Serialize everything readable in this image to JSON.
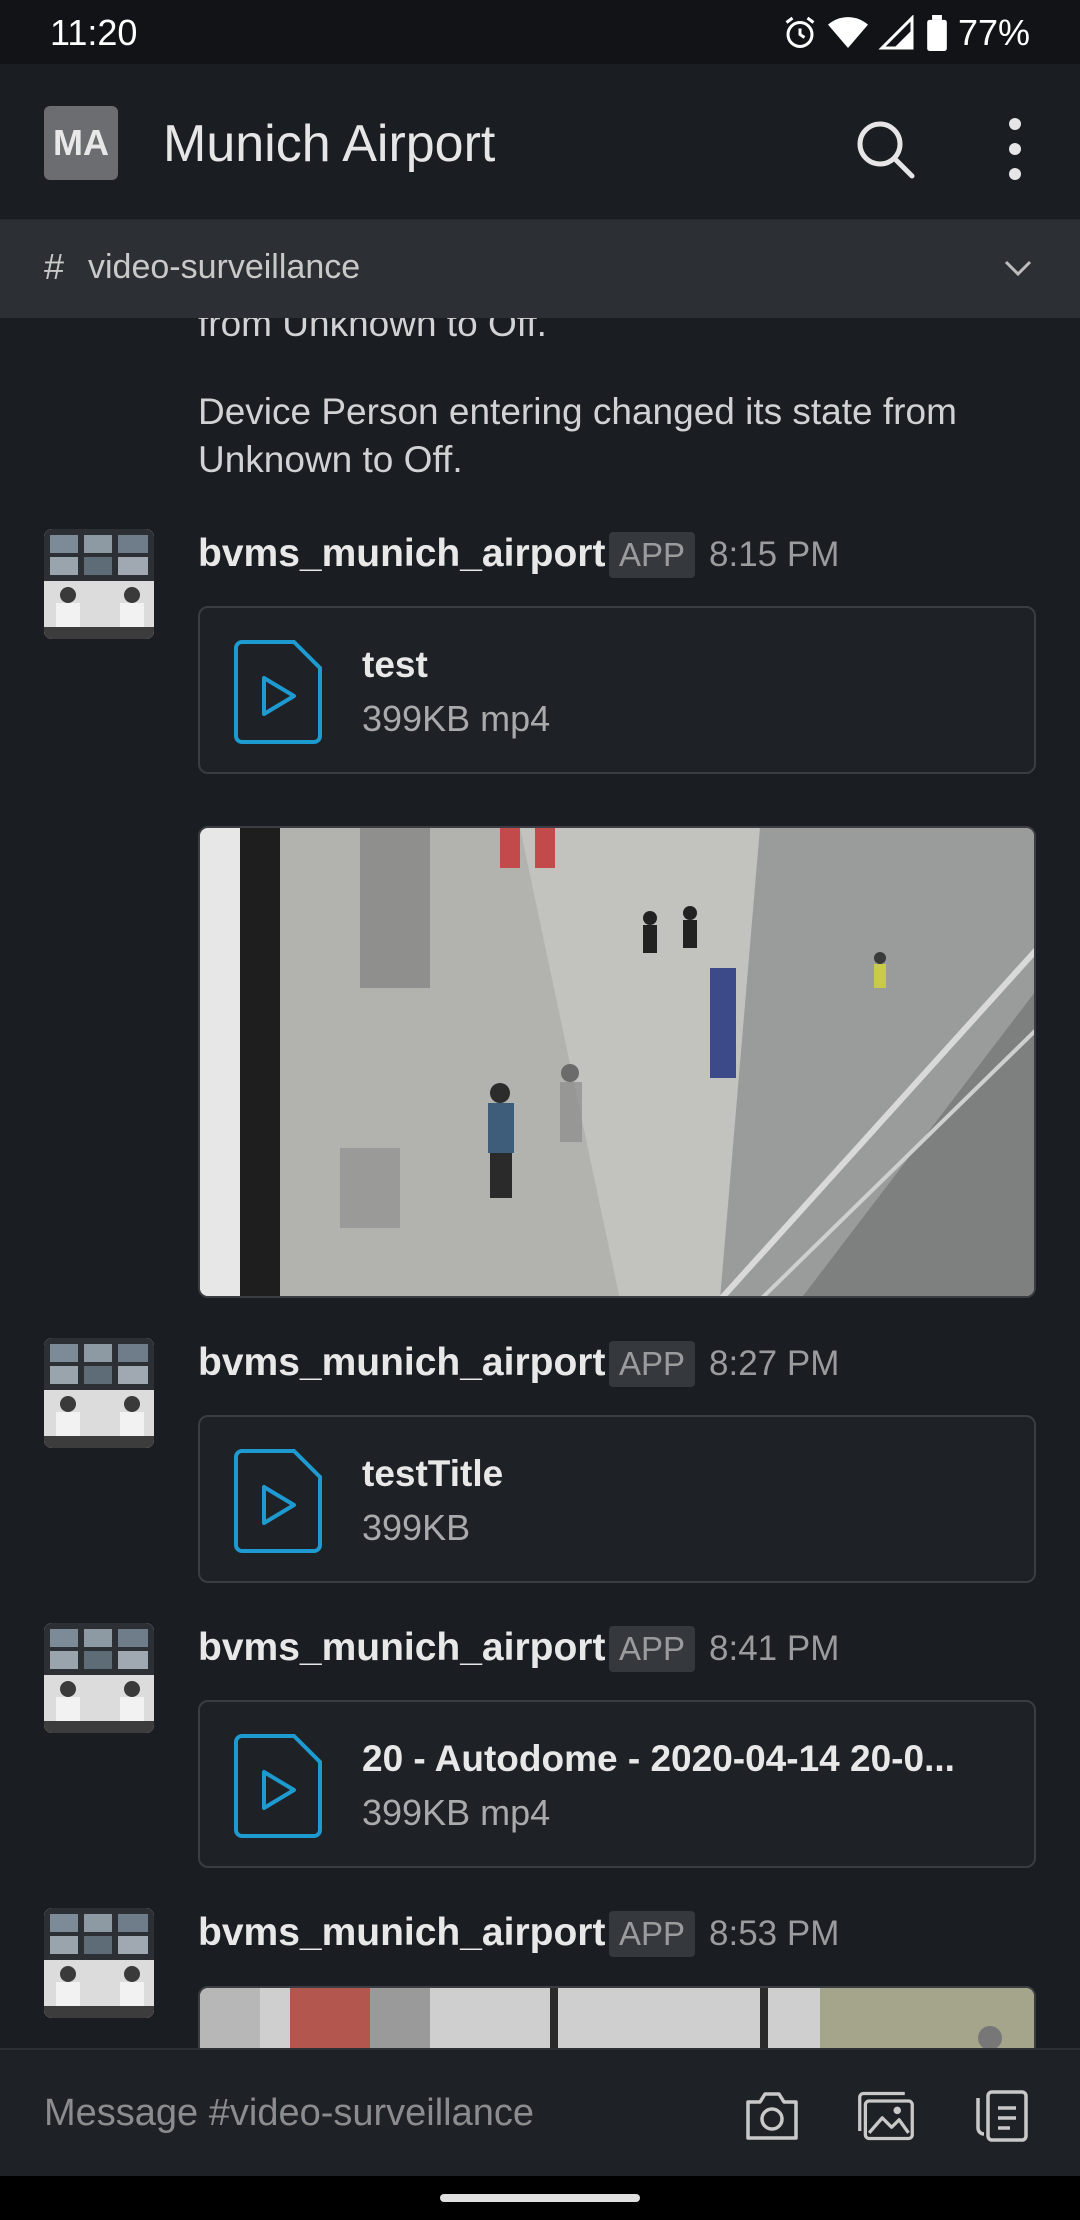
{
  "status": {
    "time": "11:20",
    "battery": "77%"
  },
  "header": {
    "workspace_initials": "MA",
    "workspace_name": "Munich Airport"
  },
  "channel": {
    "hash": "#",
    "name": "video-surveillance"
  },
  "messages": {
    "partial_text": "from Unknown to Off.",
    "device_text": "Device Person entering changed its state from Unknown to Off.",
    "items": [
      {
        "sender": "bvms_munich_airport",
        "badge": "APP",
        "time": "8:15 PM",
        "file": {
          "name": "test",
          "meta": "399KB mp4"
        }
      },
      {
        "sender": "bvms_munich_airport",
        "badge": "APP",
        "time": "8:27 PM",
        "file": {
          "name": "testTitle",
          "meta": "399KB"
        }
      },
      {
        "sender": "bvms_munich_airport",
        "badge": "APP",
        "time": "8:41 PM",
        "file": {
          "name": "20 - Autodome - 2020-04-14 20-0...",
          "meta": "399KB mp4"
        }
      },
      {
        "sender": "bvms_munich_airport",
        "badge": "APP",
        "time": "8:53 PM"
      }
    ]
  },
  "composer": {
    "placeholder": "Message #video-surveillance"
  },
  "colors": {
    "background": "#1a1d21",
    "channel_bar": "#2c2f33",
    "file_icon_accent": "#1d9bd1"
  }
}
